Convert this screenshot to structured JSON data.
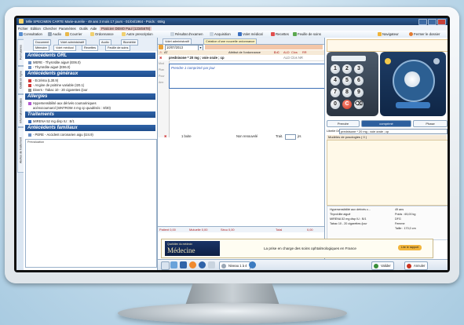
{
  "window": {
    "title": "Mlle SPECIMEN CARTE Marie-aurelie - 49 ans 3 mois 17 jours - 01/04/1964 - Poids : 65kg"
  },
  "menu": [
    "Fichier",
    "Edition",
    "Chercher",
    "Paramètres",
    "Outils",
    "Aide",
    "Praticien DEMO Paul (12345678)"
  ],
  "toolbar": {
    "items": [
      "Consultation",
      "Audio",
      "Courrier",
      "Ordonnance",
      "Autre prescription",
      "Résultat d'examen",
      "Acquisition",
      "Volet médical",
      "Recettes",
      "Feuille de soins"
    ],
    "navigator": "Navigateur",
    "close_file": "Fermer le dossier"
  },
  "vertical_tabs": [
    "Formulaires",
    "Outils en ligne",
    "Informations locales",
    "Alertes de traitement"
  ],
  "left_tabs": [
    "Document",
    "Volet administratif",
    "Audio",
    "Biométrie",
    "Mémoire",
    "Volet médical",
    "Recettes",
    "Feuille de soins"
  ],
  "sections": [
    {
      "title": "Antécédents ORL",
      "items": [
        "MERE - Thyroïdite aiguë (E06.0)",
        "- Thyroïdite aiguë (E06.0)"
      ]
    },
    {
      "title": "Antécédents généraux",
      "items": [
        "- Eczéma (L30.9)",
        "- Angine de poitrine variable (I20.1)",
        "Divers - Tabac 10 - 20 cigarettes /jour"
      ]
    },
    {
      "title": "Allergies",
      "items": [
        "Hypersensibilité aux dérivés coumariniques",
        "acénocoumarol (SINTROM 4 mg cp quadriséc : 8/30)"
      ]
    },
    {
      "title": "Traitements",
      "items": [
        "MIRENA 52 mg disp IU : B/1"
      ]
    },
    {
      "title": "Antécédents familiaux",
      "items": [
        "- PERE - Accident coronarien aigu (I24.9)"
      ]
    }
  ],
  "prevaluation_label": "Prévaluation",
  "center": {
    "tabs": [
      "Volet administratif",
      "Création d'une nouvelle ordonnance"
    ],
    "date": "10/07/2013",
    "header_cols": [
      "Attribut de l'ordonnance",
      "D.C",
      "ALD",
      "Clos",
      "RR"
    ],
    "prescription": "prednisone * 20 mg ; voie orale ; cp",
    "prescription_flags": "ALD  Clos  NR",
    "left_labels": [
      "Mod",
      "Plan",
      "Pour",
      "Ann"
    ],
    "posology": "Prendre 1 comprimé par jour",
    "qty": "1 boite",
    "renewal": "Non renouvelé",
    "trait_label": "Trait.",
    "trait_unit": "jrs",
    "totals": [
      "Patient 0,00",
      "Mutuelle 0,00",
      "Sécu 0,00",
      "Total",
      "0,00"
    ]
  },
  "banner": {
    "logo_small": "Quotidien du médecin",
    "logo_big": "Médecine",
    "text": "La prise en charge des soins ophtalmologiques en France",
    "button": "Lire le rapport"
  },
  "right": {
    "keys": [
      "1",
      "2",
      "3",
      "4",
      "5",
      "6",
      "7",
      "8",
      "9",
      "0",
      "C",
      "⌫"
    ],
    "buttons": [
      "Prendre",
      "comprimé",
      "Phase"
    ],
    "libelle_label": "Libellé DCI",
    "libelle_value": "prednisone * 20 mg ; voie orale ; cp",
    "model_header": "Modèles de posologies ( 0 )",
    "alerts_left": [
      "Hypersensibilité aux dérivés c...",
      "Thyroïdite aiguë",
      "MIRENA 52 mg disp IU : B/1",
      "Tabac 10 - 20 cigarettes /jour"
    ],
    "alerts_right": [
      "49 ans",
      "Poids : 65,00 kg",
      "DFG",
      "Femme",
      "Taille : 170,0 cm"
    ]
  },
  "bottom": {
    "level": "Niveau 1 à 4",
    "validate": "Valider",
    "cancel": "Annuler"
  },
  "colors": {
    "title_blue": "#1f4d8c",
    "section_blue": "#2f63a8",
    "accent_orange": "#f2b53c",
    "validate_green": "#3a8f3a",
    "cancel_red": "#c93320"
  }
}
